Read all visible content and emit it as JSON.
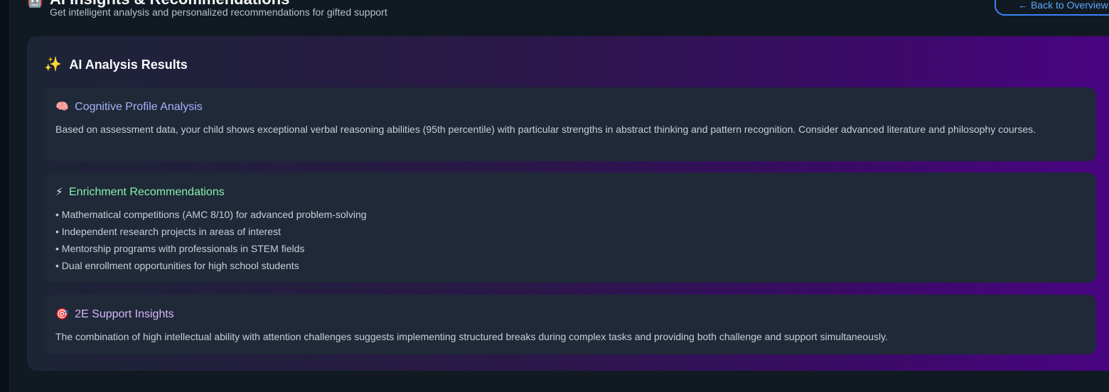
{
  "header": {
    "icon": "robot-icon",
    "title": "AI Insights & Recommendations",
    "subtitle": "Get intelligent analysis and personalized recommendations for gifted support",
    "back_label": "← Back to Overview"
  },
  "panel": {
    "icon": "sparkles-icon",
    "title": "AI Analysis Results",
    "cards": [
      {
        "icon": "brain-icon",
        "title": "Cognitive Profile Analysis",
        "title_color": "#a5b4fc",
        "body": "Based on assessment data, your child shows exceptional verbal reasoning abilities (95th percentile) with particular strengths in abstract thinking and pattern recognition. Consider advanced literature and philosophy courses."
      },
      {
        "icon": "lightning-icon",
        "title": "Enrichment Recommendations",
        "title_color": "#86efac",
        "items": [
          "Mathematical competitions (AMC 8/10) for advanced problem-solving",
          "Independent research projects in areas of interest",
          "Mentorship programs with professionals in STEM fields",
          "Dual enrollment opportunities for high school students"
        ]
      },
      {
        "icon": "target-icon",
        "title": "2E Support Insights",
        "title_color": "#d8b4fe",
        "body": "The combination of high intellectual ability with attention challenges suggests implementing structured breaks during complex tasks and providing both challenge and support simultaneously."
      }
    ]
  },
  "colors": {
    "accent": "#3b82f6",
    "card_bg": "#1f2937",
    "panel_gradient_end": "#4a0483"
  }
}
